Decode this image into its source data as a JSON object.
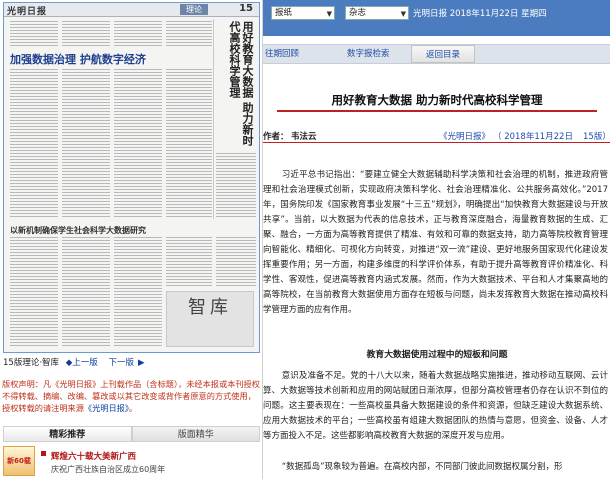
{
  "paper_page": {
    "masthead": "光明日报",
    "section_tag": "理论",
    "page_number": "15",
    "headline": "加强数据治理  护航数字经济",
    "vertical_headline": "用好教育大数据 助力新时代高校科学管理",
    "sub_headline": "以新机制确保学生社会科学大数据研究",
    "stamp": "智库"
  },
  "page_nav": {
    "page_label": "15版理论·智库",
    "prev": "上一版",
    "next": "下一版"
  },
  "copyright": {
    "text": "版权声明：凡《光明日报》上刊载作品（含标题），未经本报或本刊授权不得转载、摘编、改编、篡改或以其它改变或背作者原意的方式使用，授权转载的请注明来源",
    "link": "《光明日报》",
    "end": "。"
  },
  "left_tabs": {
    "tab1": "精彩推荐",
    "tab2": "版面精华"
  },
  "promo": {
    "thumb_text": "新60载",
    "title": "辉煌六十载大美新广西",
    "desc": "庆祝广西壮族自治区成立60周年"
  },
  "top_bar": {
    "search_type": "报纸",
    "publication": "杂志",
    "info": "光明日报  2018年11月22日 星期四"
  },
  "tabs": {
    "prev_period": "往期回顾",
    "digital_search": "数字报检索",
    "back_home": "返回目录"
  },
  "article": {
    "title": "用好教育大数据 助力新时代高校科学管理",
    "author_label": "作者：",
    "author": "韦法云",
    "source": "《光明日报》",
    "date": "（ 2018年11月22日",
    "page": "15版）",
    "para1": "习近平总书记指出：“要建立健全大数据辅助科学决策和社会治理的机制，推进政府管理和社会治理模式创新，实现政府决策科学化、社会治理精准化、公共服务高效化。”2017年，国务院印发《国家教育事业发展“十三五”规划》，明确提出“加快教育大数据建设与开放共享”。当前，以大数据为代表的信息技术，正与教育深度融合，海量教育数据的生成、汇聚、融合，一方面为高等教育提供了精准、有效和可靠的数据支持，助力高等院校教育管理向智能化、精细化、可视化方向转变，对推进“双一流”建设、更好地服务国家现代化建设发挥重要作用；另一方面，构建多维度的科学评价体系，有助于提升高等教育评价精准化、科学性、客观性，促进高等教育内涵式发展。然而，作为大数据技术、平台和人才集聚高地的高等院校，在当前教育大数据使用方面存在短板与问题，尚未发挥教育大数据在推动高校科学管理方面的应有作用。",
    "section_head": "教育大数据使用过程中的短板和问题",
    "para2": "意识及准备不足。党的十八大以来，随着大数据战略实施推进，推动移动互联网、云计算、大数据等技术创新和应用的网站赋团日渐浓厚，但部分高校管理者仍存在认识不到位的问题。这主要表现在：一些高校虽具备大数据建设的条件和资源，但缺乏建设大数据系统、应用大数据技术的平台；一些高校虽有组建大数据团队的热情与意愿，但资金、设备、人才等方面投入不足。这些都影响高校教育大数据的深度开发与应用。",
    "para3": "“数据孤岛”现象较为普遍。在高校内部，不同部门彼此间数据权属分割，形"
  }
}
